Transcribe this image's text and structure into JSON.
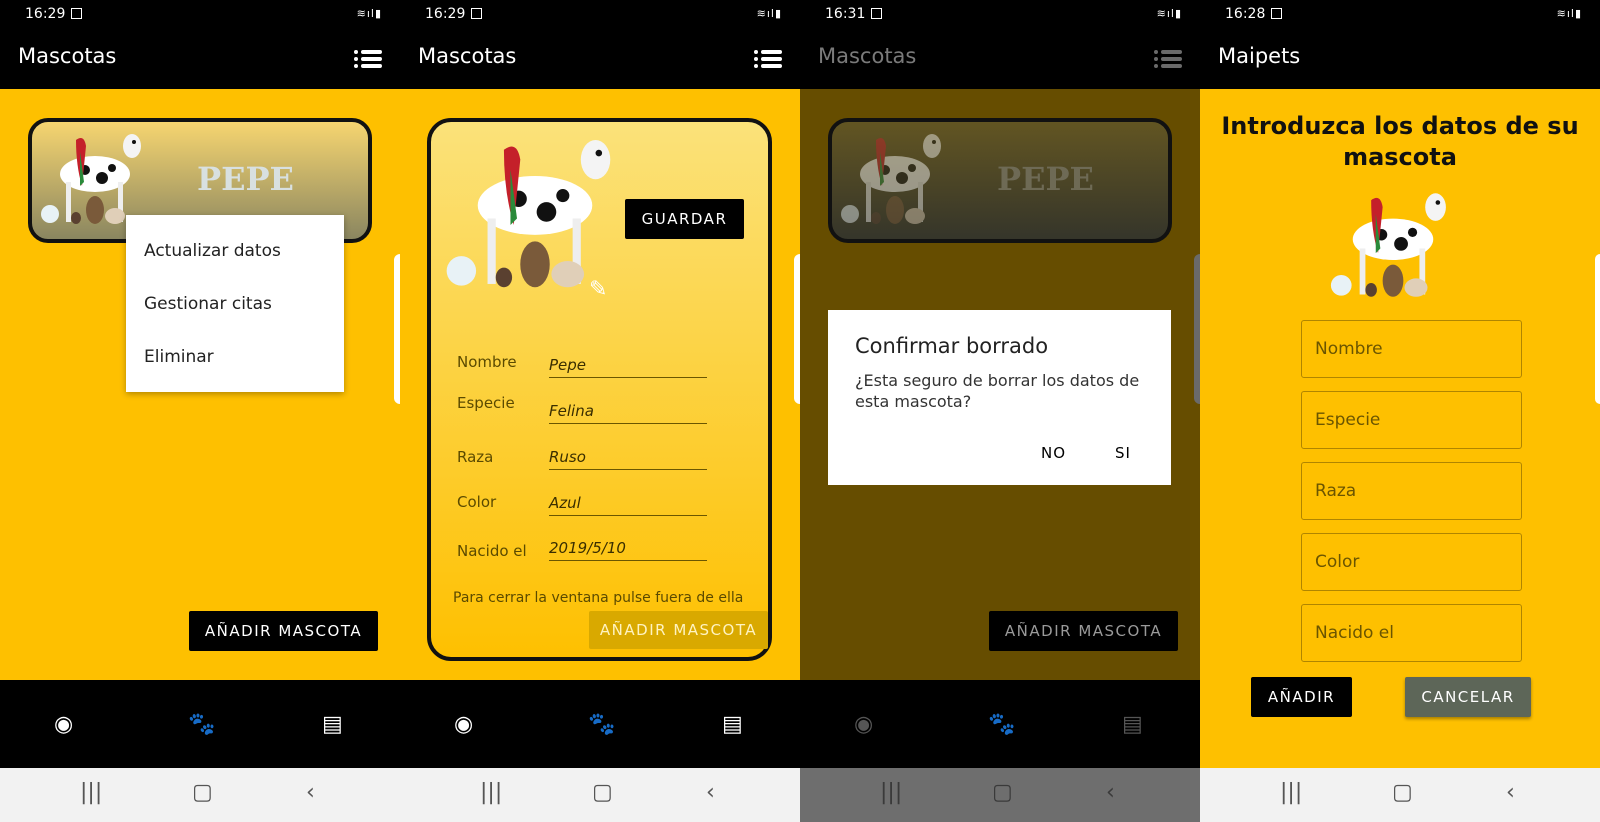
{
  "screens": [
    {
      "time": "16:29",
      "title": "Mascotas",
      "card_name": "PEPE",
      "menu": [
        "Actualizar datos",
        "Gestionar citas",
        "Eliminar"
      ],
      "add_button": "AÑADIR MASCOTA"
    },
    {
      "time": "16:29",
      "title": "Mascotas",
      "save_button": "GUARDAR",
      "fields": [
        {
          "label": "Nombre",
          "value": "Pepe"
        },
        {
          "label": "Especie",
          "value": "Felina"
        },
        {
          "label": "Raza",
          "value": "Ruso"
        },
        {
          "label": "Color",
          "value": "Azul"
        },
        {
          "label": "Nacido el",
          "value": "2019/5/10"
        }
      ],
      "hint": "Para cerrar la ventana pulse fuera de ella",
      "add_button": "AÑADIR MASCOTA"
    },
    {
      "time": "16:31",
      "title": "Mascotas",
      "card_name": "PEPE",
      "dialog_title": "Confirmar borrado",
      "dialog_message": "¿Esta seguro de borrar los datos de esta mascota?",
      "no": "NO",
      "si": "SI",
      "add_button": "AÑADIR MASCOTA"
    },
    {
      "time": "16:28",
      "title": "Maipets",
      "heading": "Introduzca los datos de su mascota",
      "placeholders": [
        "Nombre",
        "Especie",
        "Raza",
        "Color",
        "Nacido el"
      ],
      "add": "AÑADIR",
      "cancel": "CANCELAR"
    }
  ],
  "colors": {
    "accent": "#fec000",
    "bar": "#000000",
    "cancel": "#5d6658"
  },
  "icons": {
    "bottom_nav": [
      "account-circle-icon",
      "paw-icon",
      "store-icon"
    ],
    "system_nav": [
      "recents-icon",
      "home-icon",
      "back-icon"
    ]
  }
}
